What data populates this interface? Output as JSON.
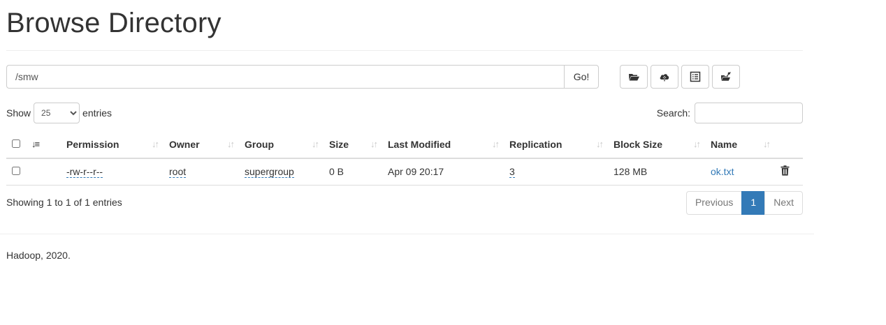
{
  "page": {
    "title": "Browse Directory"
  },
  "path_bar": {
    "value": "/smw",
    "go_label": "Go!"
  },
  "toolbar": {
    "buttons": [
      {
        "icon": "folder-open-icon"
      },
      {
        "icon": "cloud-upload-icon"
      },
      {
        "icon": "list-alt-icon"
      },
      {
        "icon": "scissors-folder-icon"
      }
    ]
  },
  "length_menu": {
    "show_label": "Show",
    "selected": "25",
    "entries_label": "entries"
  },
  "search": {
    "label": "Search:",
    "value": ""
  },
  "table": {
    "headers": [
      "Permission",
      "Owner",
      "Group",
      "Size",
      "Last Modified",
      "Replication",
      "Block Size",
      "Name"
    ],
    "rows": [
      {
        "permission": "-rw-r--r--",
        "owner": "root",
        "group": "supergroup",
        "size": "0 B",
        "last_modified": "Apr 09 20:17",
        "replication": "3",
        "block_size": "128 MB",
        "name": "ok.txt"
      }
    ]
  },
  "info": {
    "text": "Showing 1 to 1 of 1 entries"
  },
  "pagination": {
    "previous": "Previous",
    "current": "1",
    "next": "Next"
  },
  "footer": {
    "text": "Hadoop, 2020."
  },
  "colors": {
    "link": "#337ab7",
    "border": "#cccccc",
    "active_page": "#337ab7"
  }
}
